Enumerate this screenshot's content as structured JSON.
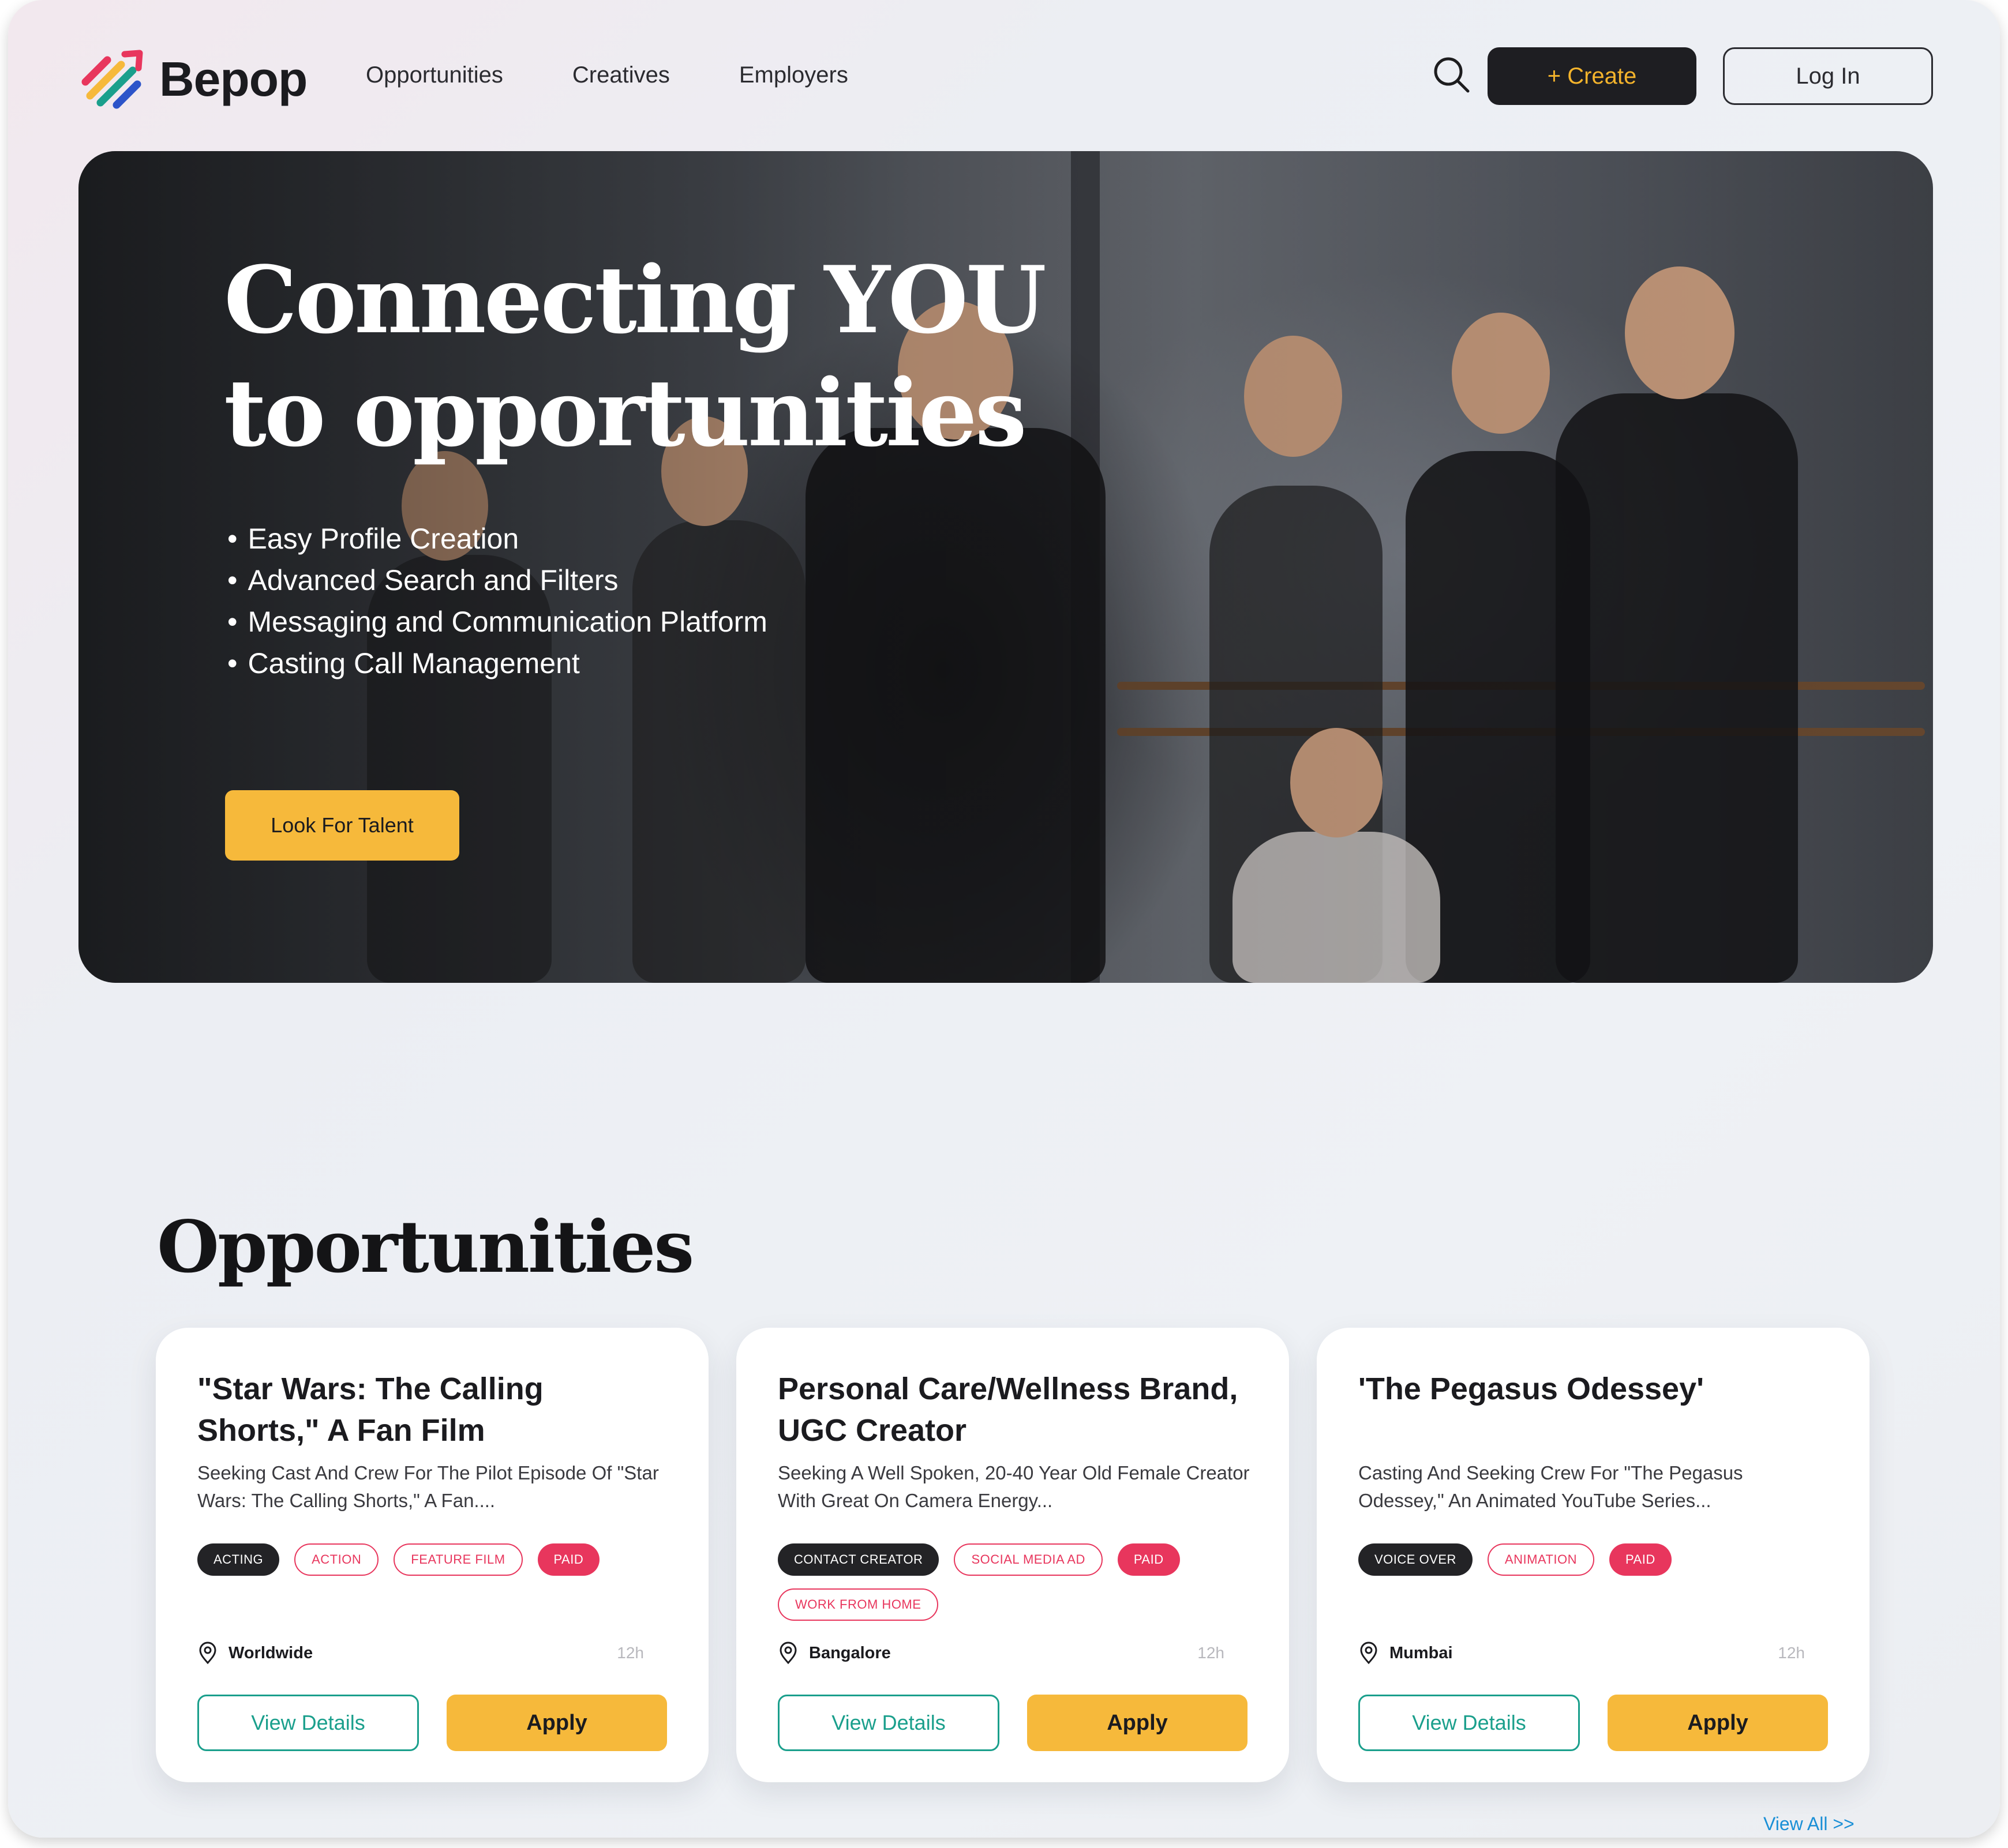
{
  "brand": {
    "name": "Bepop",
    "accent": "#f6b93b",
    "dark": "#1e1e22",
    "pink": "#e8365d",
    "teal": "#1a9f8c"
  },
  "nav": {
    "links": [
      "Opportunities",
      "Creatives",
      "Employers"
    ],
    "search_icon": "search-icon",
    "create_label": "+ Create",
    "login_label": "Log In"
  },
  "hero": {
    "title_line1": "Connecting YOU",
    "title_line2": "to opportunities",
    "bullets": [
      "Easy Profile Creation",
      "Advanced Search and Filters",
      "Messaging and Communication Platform",
      "Casting Call Management"
    ],
    "cta_label": "Look For Talent"
  },
  "opportunities": {
    "title": "Opportunities",
    "view_all": "View All  >>",
    "cards": [
      {
        "title": "\"Star Wars: The Calling Shorts,\" A Fan Film",
        "description": "Seeking Cast And Crew For The Pilot Episode Of \"Star Wars: The Calling Shorts,\" A Fan....",
        "tags": [
          {
            "label": "Acting",
            "style": "dark"
          },
          {
            "label": "Action",
            "style": "outline"
          },
          {
            "label": "Feature Film",
            "style": "outline"
          },
          {
            "label": "Paid",
            "style": "paid"
          }
        ],
        "location": "Worldwide",
        "time": "12h",
        "details_label": "View Details",
        "apply_label": "Apply"
      },
      {
        "title": "Personal Care/Wellness Brand, UGC Creator",
        "description": "Seeking A Well Spoken, 20-40 Year Old Female Creator With Great On Camera Energy...",
        "tags": [
          {
            "label": "Contact Creator",
            "style": "dark"
          },
          {
            "label": "Social Media Ad",
            "style": "outline"
          },
          {
            "label": "Paid",
            "style": "paid"
          },
          {
            "label": "Work From Home",
            "style": "outline"
          }
        ],
        "location": "Bangalore",
        "time": "12h",
        "details_label": "View Details",
        "apply_label": "Apply"
      },
      {
        "title": "'The Pegasus Odessey'",
        "description": "Casting And Seeking Crew For \"The Pegasus Odessey,\" An Animated YouTube Series...",
        "tags": [
          {
            "label": "Voice Over",
            "style": "dark"
          },
          {
            "label": "Animation",
            "style": "outline"
          },
          {
            "label": "Paid",
            "style": "paid"
          }
        ],
        "location": "Mumbai",
        "time": "12h",
        "details_label": "View Details",
        "apply_label": "Apply"
      }
    ]
  }
}
